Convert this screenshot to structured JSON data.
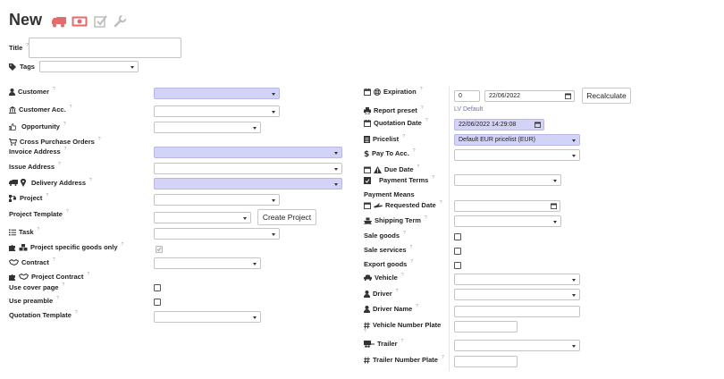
{
  "page": {
    "title": "New",
    "header_icons": [
      "truck-icon",
      "money-bill-icon",
      "check-square-icon",
      "wrench-icon"
    ],
    "accent_red": "#e26b6b",
    "required_bg": "#d2d3f7"
  },
  "left": {
    "title_label": "Title",
    "tags_label": "Tags",
    "customer_label": "Customer",
    "customer_acc_label": "Customer Acc.",
    "opportunity_label": "Opportunity",
    "cross_purchase_label": "Cross Purchase Orders",
    "invoice_address_label": "Invoice Address",
    "issue_address_label": "Issue Address",
    "delivery_address_label": "Delivery Address",
    "project_label": "Project",
    "project_template_label": "Project Template",
    "create_project_label": "Create Project",
    "task_label": "Task",
    "project_specific_label": "Project specific goods only",
    "contract_label": "Contract",
    "project_contract_label": "Project Contract",
    "cover_page_label": "Use cover page",
    "preamble_label": "Use preamble",
    "quotation_template_label": "Quotation Template"
  },
  "right": {
    "expiration_label": "Expiration",
    "expiration_days": "0",
    "expiration_date": "22/06/2022",
    "recalculate_label": "Recalculate",
    "report_preset_label": "Report preset",
    "report_preset_value": "LV Default",
    "quotation_date_label": "Quotation Date",
    "quotation_date_value": "22/06/2022 14:29:08",
    "pricelist_label": "Pricelist",
    "pricelist_value": "Default EUR pricelist (EUR)",
    "pay_to_label": "Pay To Acc.",
    "due_date_label": "Due Date",
    "payment_terms_label": "Payment Terms",
    "payment_means_label": "Payment Means",
    "requested_date_label": "Requested Date",
    "shipping_term_label": "Shipping Term",
    "sale_goods_label": "Sale goods",
    "sale_services_label": "Sale services",
    "export_goods_label": "Export goods",
    "vehicle_label": "Vehicle",
    "driver_label": "Driver",
    "driver_name_label": "Driver Name",
    "vehicle_plate_label": "Vehicle Number Plate",
    "trailer_label": "Trailer",
    "trailer_plate_label": "Trailer Number Plate"
  },
  "help_mark": "?"
}
